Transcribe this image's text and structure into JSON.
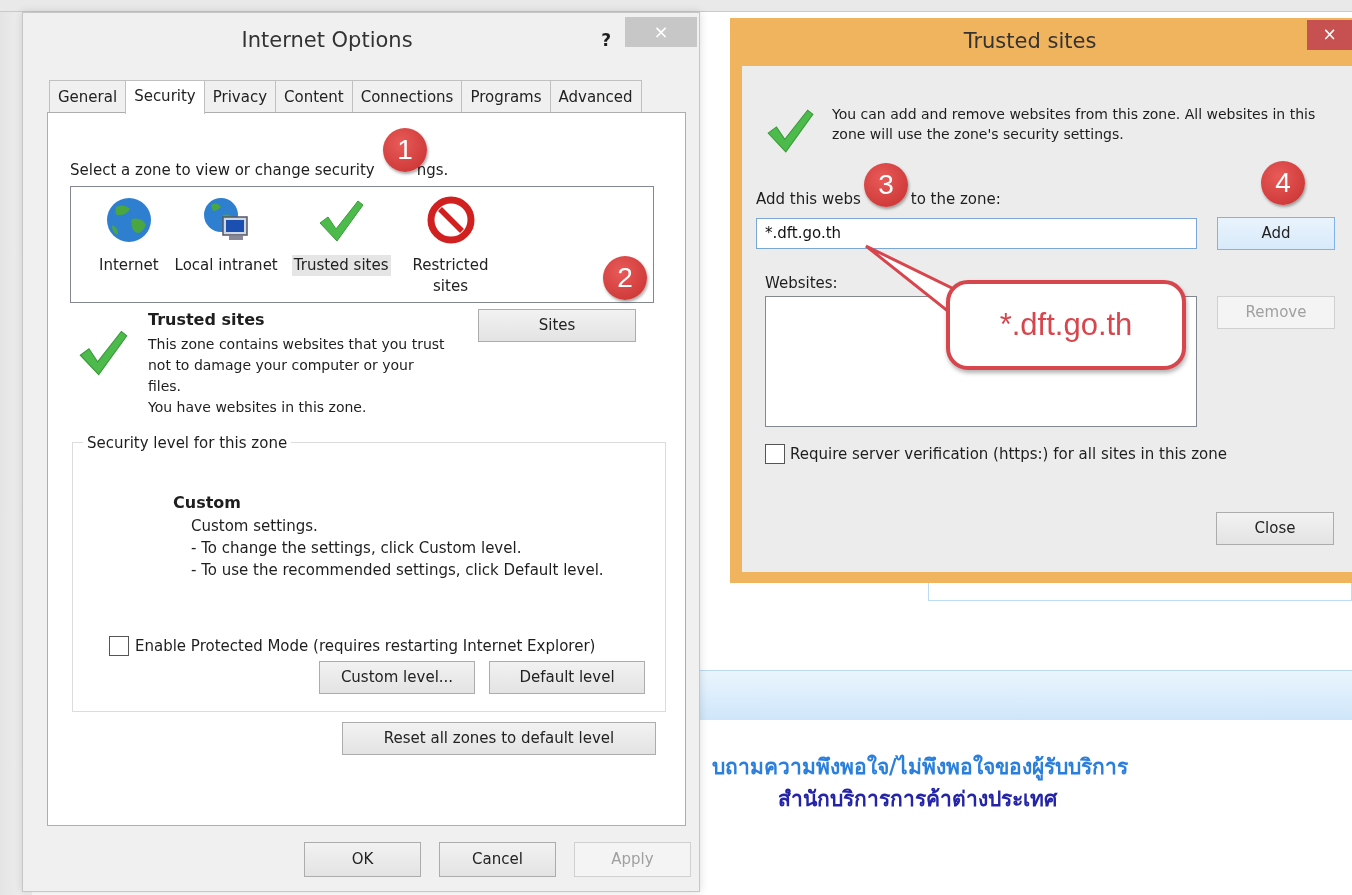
{
  "internet_options": {
    "title": "Internet Options",
    "help": "?",
    "close": "×",
    "tabs": [
      {
        "label": "General",
        "selected": false
      },
      {
        "label": "Security",
        "selected": true
      },
      {
        "label": "Privacy",
        "selected": false
      },
      {
        "label": "Content",
        "selected": false
      },
      {
        "label": "Connections",
        "selected": false
      },
      {
        "label": "Programs",
        "selected": false
      },
      {
        "label": "Advanced",
        "selected": false
      }
    ],
    "zone_prompt": [
      "Select a zone to view or change security",
      "ngs."
    ],
    "zones": [
      {
        "label": "Internet",
        "kind": "globe",
        "selected": false
      },
      {
        "label": "Local intranet",
        "kind": "intranet",
        "selected": false
      },
      {
        "label": "Trusted sites",
        "kind": "trusted",
        "selected": true
      },
      {
        "label": "Restricted sites",
        "kind": "restricted",
        "selected": false
      }
    ],
    "zone_name": "Trusted sites",
    "zone_description": [
      "This zone contains websites that you trust not to damage your computer or your files.",
      "You have websites in this zone."
    ],
    "sites_button": "Sites",
    "security_level": {
      "legend": "Security level for this zone",
      "level_name": "Custom",
      "lines": [
        "Custom settings.",
        "- To change the settings, click Custom level.",
        "- To use the recommended settings, click Default level."
      ]
    },
    "protected_mode": {
      "label": "Enable Protected Mode (requires restarting Internet Explorer)",
      "checked": false
    },
    "level_buttons": [
      "Custom level...",
      "Default level"
    ],
    "reset_button": "Reset all zones to default level",
    "footer_buttons": [
      {
        "label": "OK",
        "disabled": false
      },
      {
        "label": "Cancel",
        "disabled": false
      },
      {
        "label": "Apply",
        "disabled": true
      }
    ]
  },
  "trusted_sites": {
    "title": "Trusted sites",
    "close": "×",
    "info": "You can add and remove websites from this zone. All websites in this zone will use the zone's security settings.",
    "add_label": [
      "Add this webs",
      "to the zone:"
    ],
    "add_field": {
      "value": "*.dft.go.th"
    },
    "add_button": {
      "label": "Add",
      "disabled": false
    },
    "websites_label": "Websites:",
    "remove_button": {
      "label": "Remove",
      "disabled": true
    },
    "https_check": {
      "label": "Require server verification (https:) for all sites in this zone",
      "checked": false
    },
    "close_button": "Close"
  },
  "annotations": [
    {
      "label": "1"
    },
    {
      "label": "2"
    },
    {
      "label": "3"
    },
    {
      "label": "4"
    }
  ],
  "callout": {
    "text": "*.dft.go.th"
  },
  "page": {
    "lines": [
      "บถามความพึงพอใจ/ไม่พึงพอใจของผู้รับบริการ",
      "สำนักบริการการค้าต่างประเทศ"
    ]
  }
}
